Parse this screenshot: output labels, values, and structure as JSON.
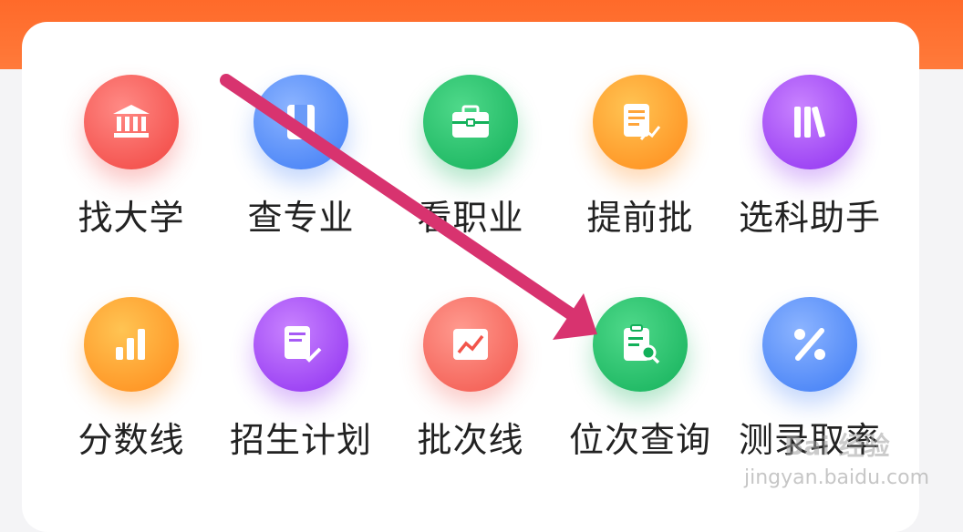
{
  "grid": {
    "items": [
      {
        "label": "找大学",
        "icon": "university-icon",
        "color": "#f1433f"
      },
      {
        "label": "查专业",
        "icon": "book-icon",
        "color": "#3d7bf5"
      },
      {
        "label": "看职业",
        "icon": "briefcase-icon",
        "color": "#13b05a"
      },
      {
        "label": "提前批",
        "icon": "document-chart-icon",
        "color": "#ff8a1a"
      },
      {
        "label": "选科助手",
        "icon": "books-icon",
        "color": "#8e2ff0"
      },
      {
        "label": "分数线",
        "icon": "bar-chart-icon",
        "color": "#ff8a1a"
      },
      {
        "label": "招生计划",
        "icon": "document-check-icon",
        "color": "#8e2ff0"
      },
      {
        "label": "批次线",
        "icon": "line-chart-icon",
        "color": "#f2554b"
      },
      {
        "label": "位次查询",
        "icon": "clipboard-search-icon",
        "color": "#13b05a"
      },
      {
        "label": "测录取率",
        "icon": "percent-icon",
        "color": "#3d7bf5"
      }
    ]
  },
  "annotation": {
    "arrow_color": "#d8336f"
  },
  "watermark": {
    "logo": "Bai 经验",
    "url": "jingyan.baidu.com"
  }
}
